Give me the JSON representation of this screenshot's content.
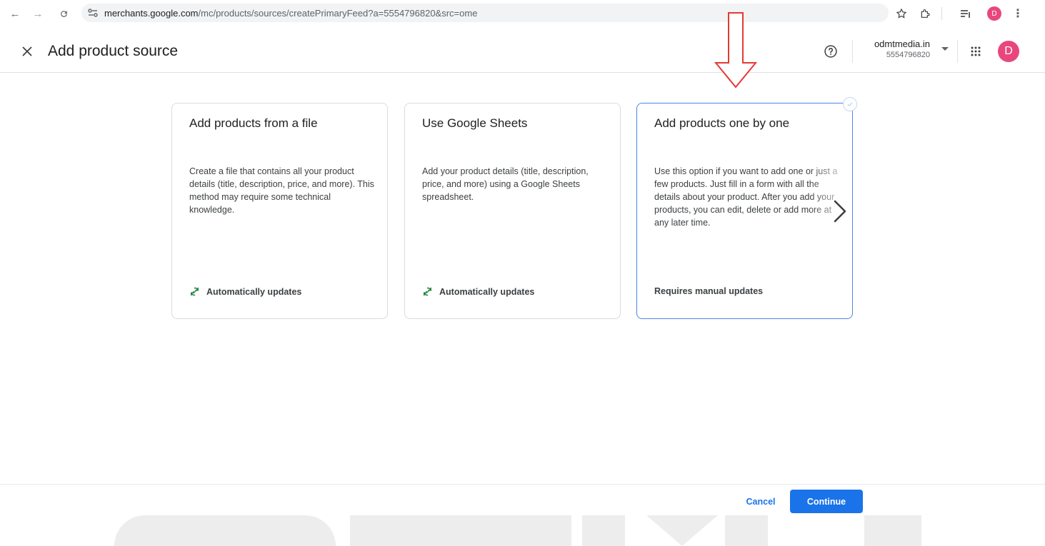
{
  "browser": {
    "url_host": "merchants.google.com",
    "url_path": "/mc/products/sources/createPrimaryFeed?a=5554796820&src=ome",
    "profile_initial": "D"
  },
  "header": {
    "title": "Add product source",
    "account_name": "odmtmedia.in",
    "account_id": "5554796820",
    "avatar_initial": "D"
  },
  "cards": [
    {
      "title": "Add products from a file",
      "description": "Create a file that contains all your product details (title, description, price, and more). This method may require some technical knowledge.",
      "footer": "Automatically updates",
      "selected": false
    },
    {
      "title": "Use Google Sheets",
      "description": "Add your product details (title, description, price, and more) using a Google Sheets spreadsheet.",
      "footer": "Automatically updates",
      "selected": false
    },
    {
      "title": "Add products one by one",
      "description": "Use this option if you want to add one or just a few products. Just fill in a form with all the details about your product. After you add your products, you can edit, delete or add more at any later time.",
      "footer": "Requires manual updates",
      "selected": true
    }
  ],
  "footer": {
    "cancel_label": "Cancel",
    "continue_label": "Continue"
  },
  "colors": {
    "accent": "#1a73e8",
    "selected_border": "#4a86e8",
    "sync_green": "#188038",
    "avatar_pink": "#e8477d",
    "annotation_red": "#e53935"
  }
}
